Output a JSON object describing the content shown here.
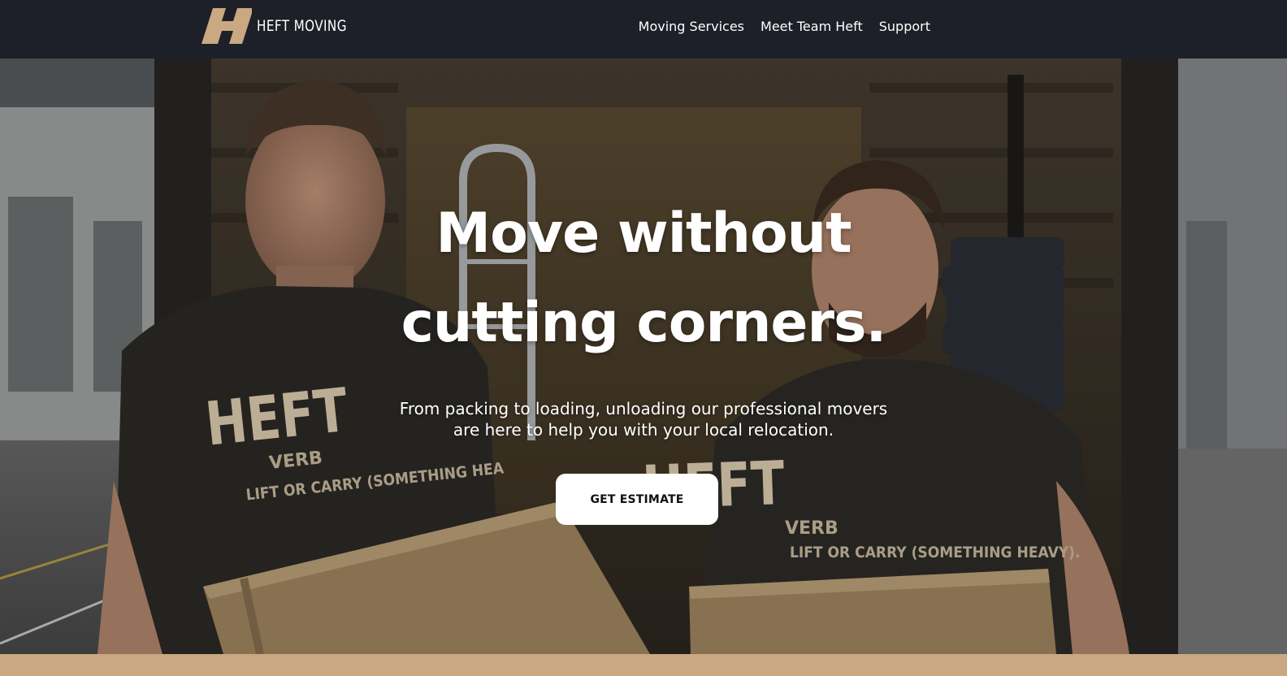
{
  "header": {
    "brand": "HEFT MOVING",
    "logo_icon": "heft-h-logo",
    "nav": [
      {
        "label": "Moving Services"
      },
      {
        "label": "Meet Team Heft"
      },
      {
        "label": "Support"
      }
    ]
  },
  "hero": {
    "headline_line1": "Move without",
    "headline_line2": "cutting corners.",
    "subtitle_line1": "From packing to loading, unloading our professional movers",
    "subtitle_line2": "are here to help you with your local relocation.",
    "cta_label": "GET ESTIMATE",
    "background_image": "two-movers-holding-boxes-photo",
    "shirt_text": {
      "word": "HEFT",
      "pos": "VERB",
      "definition_left": "LIFT OR CARRY (SOMETHING HEA",
      "definition_right": "LIFT OR CARRY (SOMETHING HEAVY)."
    }
  },
  "colors": {
    "navbar_bg": "#1d2028",
    "accent": "#c9a882",
    "cta_bg": "#ffffff",
    "text": "#ffffff"
  }
}
